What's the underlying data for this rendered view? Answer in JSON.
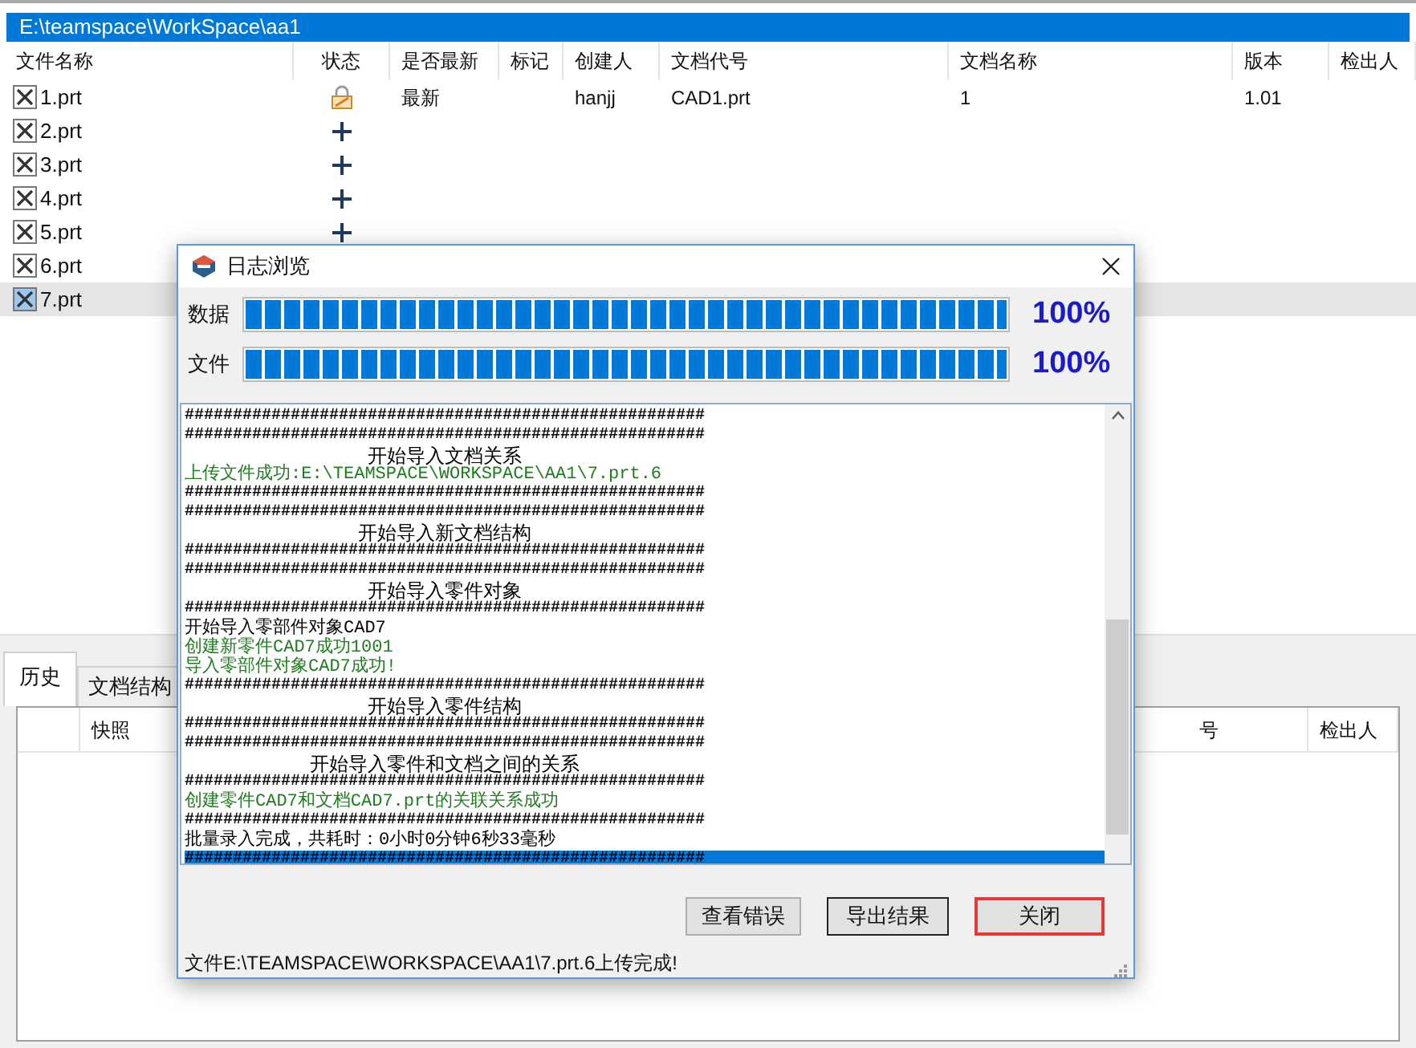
{
  "path_bar": "E:\\teamspace\\WorkSpace\\aa1",
  "file_table": {
    "columns": [
      "文件名称",
      "状态",
      "是否最新",
      "标记",
      "创建人",
      "文档代号",
      "文档名称",
      "版本",
      "检出人"
    ],
    "rows": [
      {
        "name": "1.prt",
        "status": {
          "kind": "lock"
        },
        "latest": "最新",
        "creator": "hanjj",
        "doc_code": "CAD1.prt",
        "doc_name": "1",
        "version": "1.01",
        "selected": false
      },
      {
        "name": "2.prt",
        "status": {
          "kind": "new"
        },
        "selected": false
      },
      {
        "name": "3.prt",
        "status": {
          "kind": "new"
        },
        "selected": false
      },
      {
        "name": "4.prt",
        "status": {
          "kind": "new"
        },
        "selected": false
      },
      {
        "name": "5.prt",
        "status": {
          "kind": "new"
        },
        "selected": false
      },
      {
        "name": "6.prt",
        "selected": false
      },
      {
        "name": "7.prt",
        "selected": true
      }
    ]
  },
  "bottom_tabs": [
    {
      "label": "历史",
      "selected": true
    },
    {
      "label": "文档结构",
      "selected": false
    }
  ],
  "history_table": {
    "columns": [
      "",
      "快照",
      "号",
      "检出人"
    ]
  },
  "dialog": {
    "title": "日志浏览",
    "progress": [
      {
        "label": "数据",
        "level": 1,
        "reading": "100%"
      },
      {
        "label": "文件",
        "level": 1,
        "reading": "100%"
      }
    ],
    "log": [
      {
        "kind": "hash",
        "text": "######################################################",
        "selected": false
      },
      {
        "kind": "hash",
        "text": "######################################################",
        "selected": false
      },
      {
        "kind": "heading",
        "text": "开始导入文档关系",
        "selected": false
      },
      {
        "kind": "success",
        "text": "上传文件成功:E:\\TEAMSPACE\\WORKSPACE\\AA1\\7.prt.6",
        "selected": false
      },
      {
        "kind": "hash",
        "text": "######################################################",
        "selected": false
      },
      {
        "kind": "hash",
        "text": "######################################################",
        "selected": false
      },
      {
        "kind": "heading",
        "text": "开始导入新文档结构",
        "selected": false
      },
      {
        "kind": "hash",
        "text": "######################################################",
        "selected": false
      },
      {
        "kind": "hash",
        "text": "######################################################",
        "selected": false
      },
      {
        "kind": "heading",
        "text": "开始导入零件对象",
        "selected": false
      },
      {
        "kind": "hash",
        "text": "######################################################",
        "selected": false
      },
      {
        "kind": "info",
        "text": "开始导入零部件对象CAD7",
        "selected": false
      },
      {
        "kind": "success",
        "text": "创建新零件CAD7成功1001",
        "selected": false
      },
      {
        "kind": "success",
        "text": "导入零部件对象CAD7成功!",
        "selected": false
      },
      {
        "kind": "hash",
        "text": "######################################################",
        "selected": false
      },
      {
        "kind": "heading",
        "text": "开始导入零件结构",
        "selected": false
      },
      {
        "kind": "hash",
        "text": "######################################################",
        "selected": false
      },
      {
        "kind": "hash",
        "text": "######################################################",
        "selected": false
      },
      {
        "kind": "heading",
        "text": "开始导入零件和文档之间的关系",
        "selected": false
      },
      {
        "kind": "hash",
        "text": "######################################################",
        "selected": false
      },
      {
        "kind": "success",
        "text": "创建零件CAD7和文档CAD7.prt的关联关系成功",
        "selected": false
      },
      {
        "kind": "hash",
        "text": "######################################################",
        "selected": false
      },
      {
        "kind": "info",
        "text": "批量录入完成，共耗时：0小时0分钟6秒33毫秒",
        "selected": false
      },
      {
        "kind": "hash",
        "text": "######################################################",
        "selected": true
      }
    ],
    "buttons": [
      {
        "label": "查看错误",
        "default": false,
        "highlighted": false
      },
      {
        "label": "导出结果",
        "default": true,
        "highlighted": false
      },
      {
        "label": "关闭",
        "default": false,
        "highlighted": true
      }
    ],
    "status_text": "文件E:\\TEAMSPACE\\WORKSPACE\\AA1\\7.prt.6上传完成!"
  }
}
